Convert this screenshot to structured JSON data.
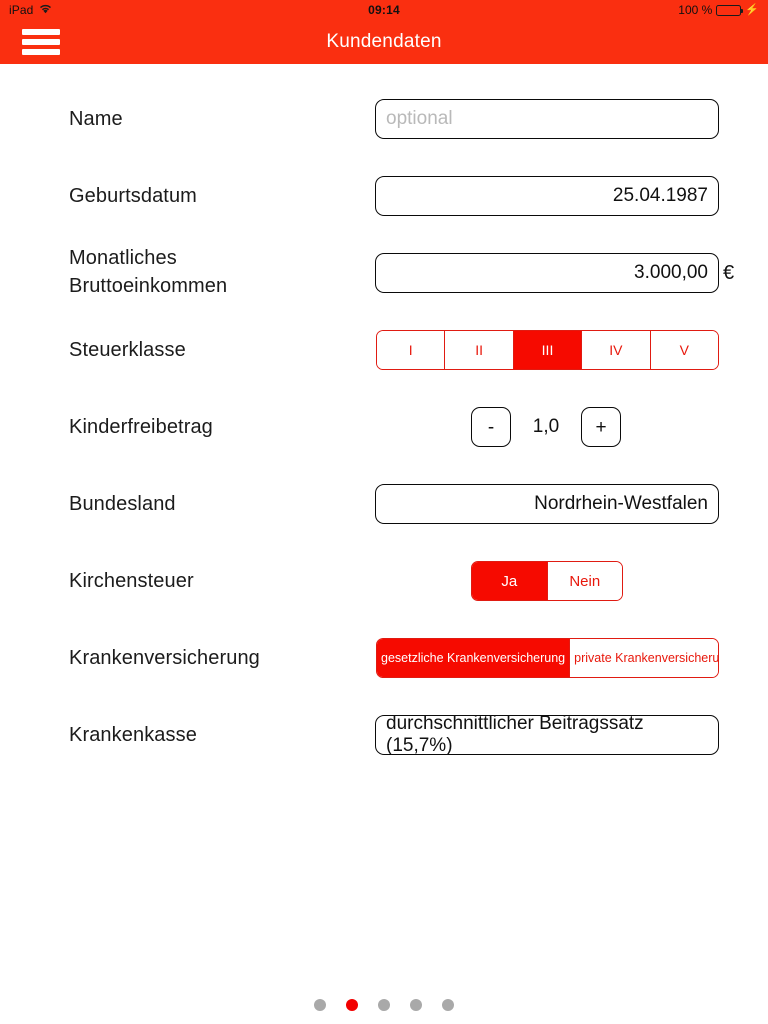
{
  "statusbar": {
    "device": "iPad",
    "wifi_icon": "wifi-icon",
    "time": "09:14",
    "battery_percent": "100 %",
    "battery_icon": "battery-full-icon",
    "charging_icon": "lightning-bolt-icon"
  },
  "navbar": {
    "menu_icon": "hamburger-menu-icon",
    "title": "Kundendaten"
  },
  "form": {
    "rows": [
      {
        "label": "Name",
        "type": "text",
        "value": "",
        "placeholder": "optional"
      },
      {
        "label": "Geburtsdatum",
        "type": "text",
        "value": "25.04.1987"
      },
      {
        "label": "Monatliches\nBruttoeinkommen",
        "label_line1": "Monatliches",
        "label_line2": "Bruttoeinkommen",
        "type": "text",
        "value": "3.000,00",
        "suffix": "€"
      },
      {
        "label": "Steuerklasse",
        "type": "segmented",
        "options": [
          "I",
          "II",
          "III",
          "IV",
          "V"
        ],
        "selected_index": 2
      },
      {
        "label": "Kinderfreibetrag",
        "type": "stepper",
        "decrement_label": "-",
        "value": "1,0",
        "increment_label": "+"
      },
      {
        "label": "Bundesland",
        "type": "text",
        "value": "Nordrhein-Westfalen"
      },
      {
        "label": "Kirchensteuer",
        "type": "segmented",
        "options": [
          "Ja",
          "Nein"
        ],
        "selected_index": 0
      },
      {
        "label": "Krankenversicherung",
        "type": "segmented",
        "options": [
          "gesetzliche Krankenversicherung",
          "private Krankenversicherung"
        ],
        "selected_index": 0
      },
      {
        "label": "Krankenkasse",
        "type": "text",
        "value": "durchschnittlicher Beitragssatz (15,7%)"
      }
    ]
  },
  "page_indicator": {
    "total": 5,
    "active_index": 1
  },
  "colors": {
    "brand_red": "#fa2f10",
    "accent_red": "#f60a00",
    "segment_border_red": "#e01b12",
    "segment_text_red": "#e8180c",
    "dot_active": "#f20000",
    "dot_inactive": "#a9a9a9",
    "battery_green": "#4cd763",
    "placeholder_gray": "#b9b9b9"
  }
}
